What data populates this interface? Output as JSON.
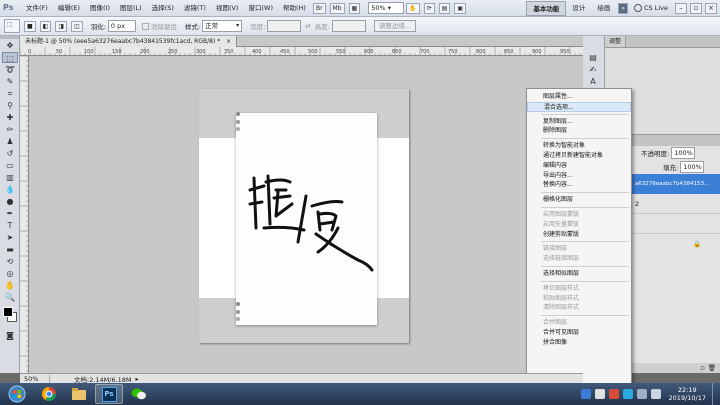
{
  "app": {
    "logo": "Ps"
  },
  "menubar": {
    "menus": [
      "文件(F)",
      "编辑(E)",
      "图像(I)",
      "图层(L)",
      "选择(S)",
      "滤镜(T)",
      "视图(V)",
      "窗口(W)",
      "帮助(H)"
    ],
    "zoom": "50%",
    "workspaces": [
      "基本功能",
      "设计",
      "绘画"
    ],
    "cs_live": "CS Live"
  },
  "options": {
    "feather_label": "羽化:",
    "feather_value": "0 px",
    "antialias_label": "消除锯齿",
    "style_label": "样式:",
    "style_value": "正常",
    "width_label": "宽度:",
    "height_label": "高度:",
    "refine_button": "调整边缘..."
  },
  "document": {
    "tab_title": "未标题-1 @ 50% (eee5a63276eaabc7b43841539fc1acd, RGB/8) *",
    "ruler_marks": [
      "0",
      "50",
      "100",
      "150",
      "200",
      "250",
      "300",
      "350",
      "400",
      "450",
      "500",
      "550",
      "600",
      "650",
      "700",
      "750",
      "800",
      "850",
      "900",
      "950"
    ],
    "calligraphy": "随便"
  },
  "context_menu": {
    "items": [
      {
        "label": "图层属性...",
        "state": "normal"
      },
      {
        "label": "混合选项...",
        "state": "highlight"
      },
      {
        "sep": true
      },
      {
        "label": "复制图层...",
        "state": "normal"
      },
      {
        "label": "删除图层",
        "state": "normal"
      },
      {
        "sep": true
      },
      {
        "label": "转换为智能对象",
        "state": "normal"
      },
      {
        "label": "通过拷贝新建智能对象",
        "state": "normal"
      },
      {
        "label": "编辑内容",
        "state": "normal"
      },
      {
        "label": "导出内容...",
        "state": "normal"
      },
      {
        "label": "替换内容...",
        "state": "normal"
      },
      {
        "sep": true
      },
      {
        "label": "栅格化图层",
        "state": "normal"
      },
      {
        "sep": true
      },
      {
        "label": "启用图层蒙版",
        "state": "disabled"
      },
      {
        "label": "启用矢量蒙版",
        "state": "disabled"
      },
      {
        "label": "创建剪贴蒙版",
        "state": "normal"
      },
      {
        "sep": true
      },
      {
        "label": "链接图层",
        "state": "disabled"
      },
      {
        "label": "选择链接图层",
        "state": "disabled"
      },
      {
        "sep": true
      },
      {
        "label": "选择相似图层",
        "state": "normal"
      },
      {
        "sep": true
      },
      {
        "label": "拷贝图层样式",
        "state": "disabled"
      },
      {
        "label": "粘贴图层样式",
        "state": "disabled"
      },
      {
        "label": "清除图层样式",
        "state": "disabled"
      },
      {
        "sep": true
      },
      {
        "label": "合并图层",
        "state": "disabled"
      },
      {
        "label": "合并可见图层",
        "state": "normal"
      },
      {
        "label": "拼合图像",
        "state": "normal"
      }
    ]
  },
  "panel": {
    "tab": "调整",
    "opacity_label": "不透明度:",
    "opacity_value": "100%",
    "fill_label": "填充:",
    "fill_value": "100%",
    "layer_name": "a63276eaabc7b4384153...",
    "layer_num": "2"
  },
  "status": {
    "zoom": "50%",
    "doc": "文档:2.14M/6.18M"
  },
  "taskbar": {
    "time": "22:19",
    "date": "2019/10/17"
  }
}
